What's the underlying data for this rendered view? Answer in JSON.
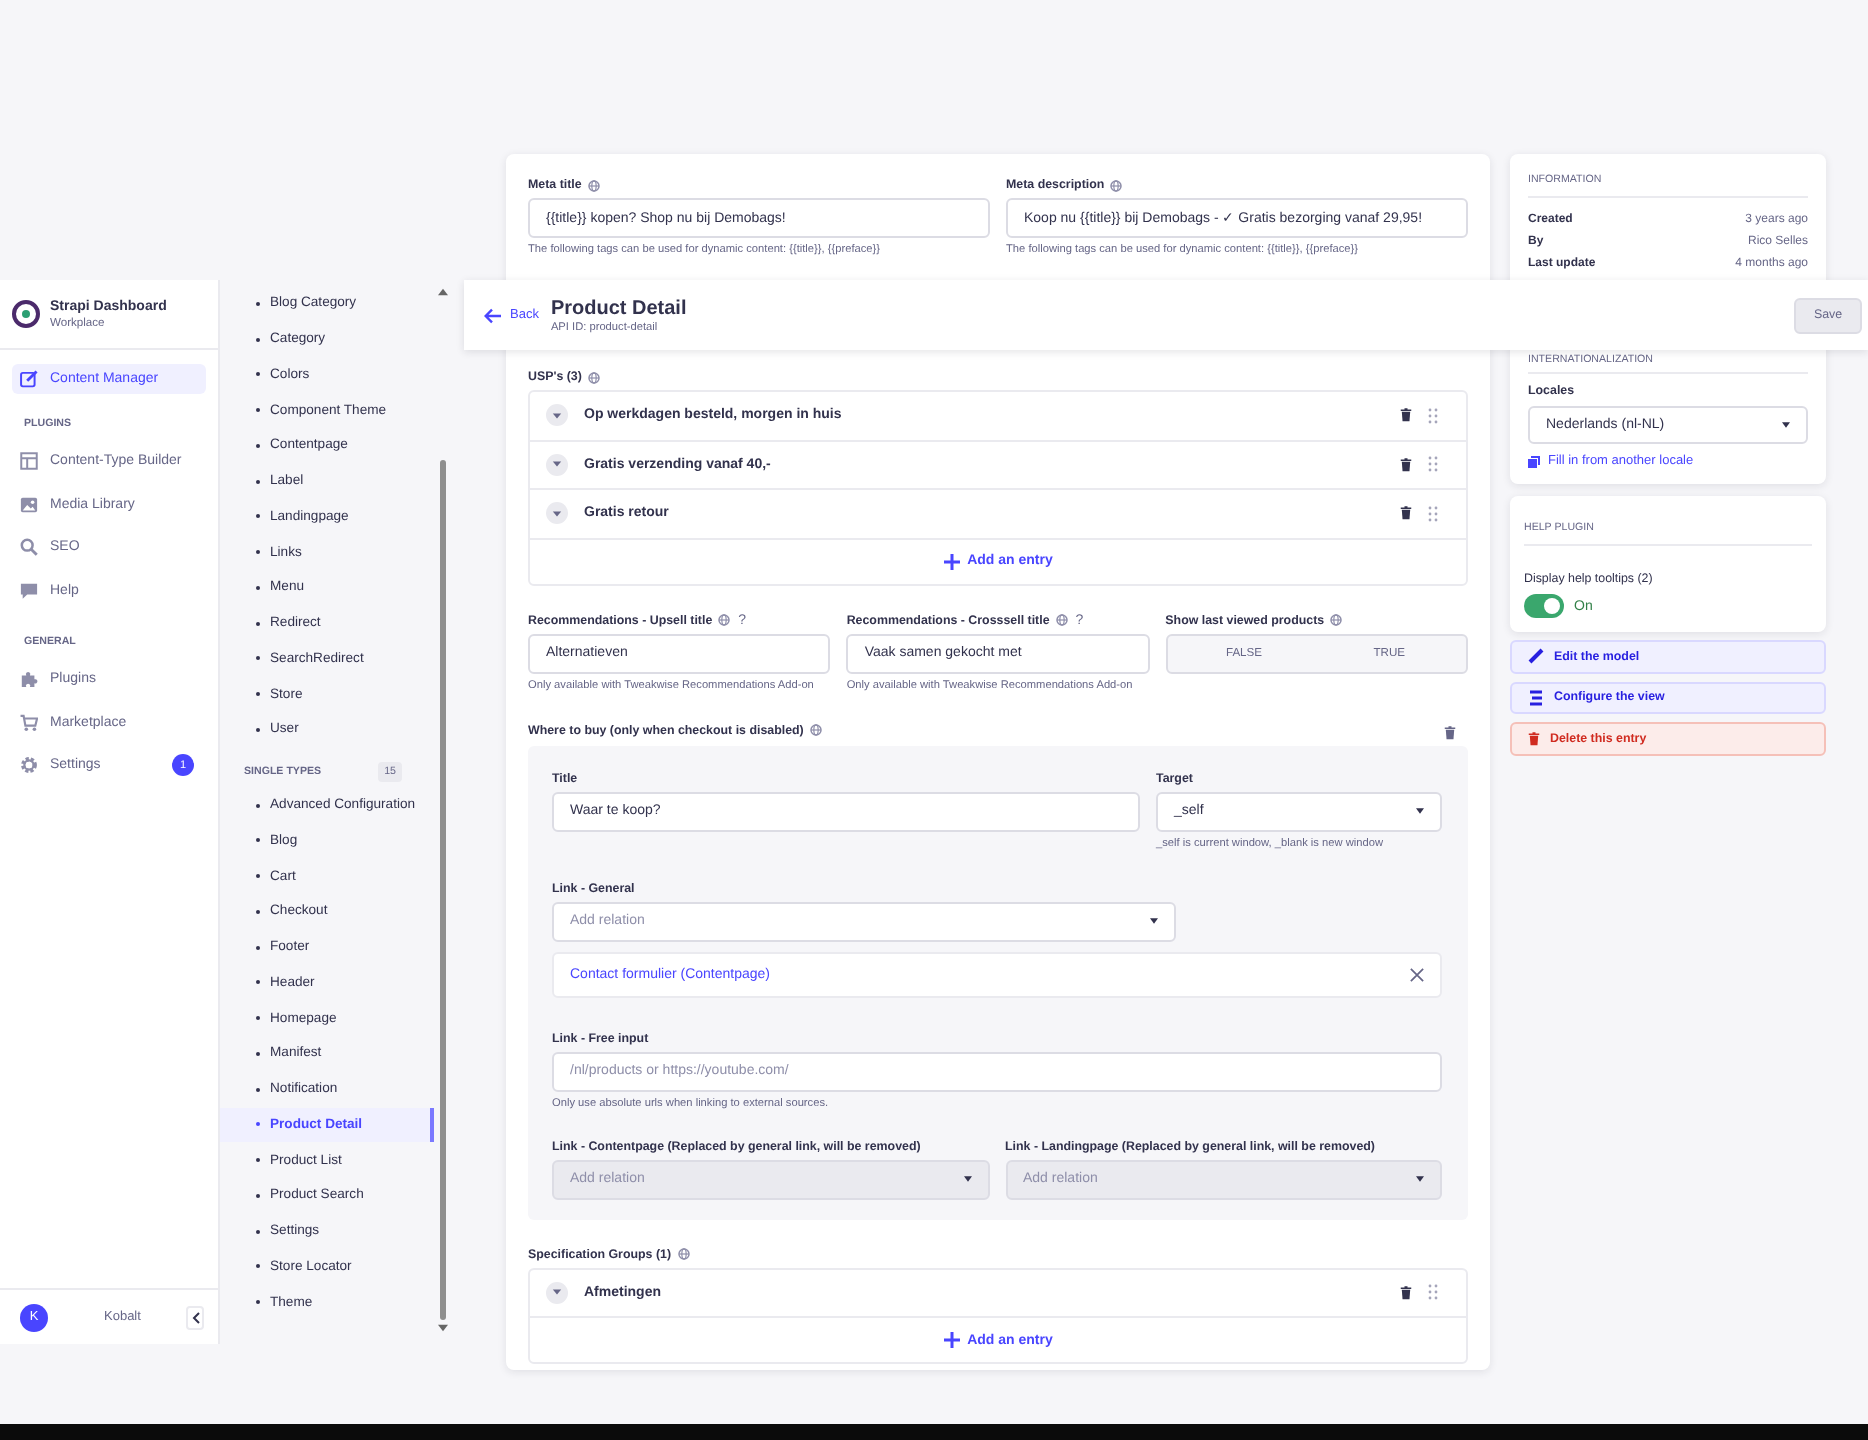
{
  "sidebar": {
    "brand": {
      "title": "Strapi Dashboard",
      "subtitle": "Workplace"
    },
    "items": [
      {
        "label": "Content Manager",
        "selected": true
      }
    ],
    "groups": [
      {
        "heading": "PLUGINS",
        "items": [
          {
            "label": "Content-Type Builder",
            "selected": false
          },
          {
            "label": "Media Library",
            "selected": false
          },
          {
            "label": "SEO",
            "selected": false
          },
          {
            "label": "Help",
            "selected": false
          }
        ]
      },
      {
        "heading": "GENERAL",
        "items": [
          {
            "label": "Plugins",
            "selected": false
          },
          {
            "label": "Marketplace",
            "selected": false
          },
          {
            "label": "Settings",
            "selected": false,
            "badge": "1"
          }
        ]
      }
    ],
    "user": {
      "initial": "K",
      "name": "Kobalt"
    }
  },
  "content_types": {
    "collection_types": [
      {
        "label": "Blog Category",
        "selected": false
      },
      {
        "label": "Category",
        "selected": false
      },
      {
        "label": "Colors",
        "selected": false
      },
      {
        "label": "Component Theme",
        "selected": false
      },
      {
        "label": "Contentpage",
        "selected": false
      },
      {
        "label": "Label",
        "selected": false
      },
      {
        "label": "Landingpage",
        "selected": false
      },
      {
        "label": "Links",
        "selected": false
      },
      {
        "label": "Menu",
        "selected": false
      },
      {
        "label": "Redirect",
        "selected": false
      },
      {
        "label": "SearchRedirect",
        "selected": false
      },
      {
        "label": "Store",
        "selected": false
      },
      {
        "label": "User",
        "selected": false
      }
    ],
    "single_types": {
      "heading": "SINGLE TYPES",
      "count": "15",
      "items": [
        {
          "label": "Advanced Configuration",
          "selected": false
        },
        {
          "label": "Blog",
          "selected": false
        },
        {
          "label": "Cart",
          "selected": false
        },
        {
          "label": "Checkout",
          "selected": false
        },
        {
          "label": "Footer",
          "selected": false
        },
        {
          "label": "Header",
          "selected": false
        },
        {
          "label": "Homepage",
          "selected": false
        },
        {
          "label": "Manifest",
          "selected": false
        },
        {
          "label": "Notification",
          "selected": false
        },
        {
          "label": "Product Detail",
          "selected": true
        },
        {
          "label": "Product List",
          "selected": false
        },
        {
          "label": "Product Search",
          "selected": false
        },
        {
          "label": "Settings",
          "selected": false
        },
        {
          "label": "Store Locator",
          "selected": false
        },
        {
          "label": "Theme",
          "selected": false
        }
      ]
    }
  },
  "header": {
    "back": "Back",
    "title": "Product Detail",
    "api_id": "API ID: product-detail",
    "save": {
      "label": "Save",
      "disabled": true
    }
  },
  "form": {
    "meta": [
      {
        "label": "Meta title",
        "localized": true,
        "value": "{{title}} kopen? Shop nu bij Demobags!",
        "hint": "The following tags can be used for dynamic content: {{title}}, {{preface}}"
      },
      {
        "label": "Meta description",
        "localized": true,
        "value": "Koop nu {{title}} bij Demobags - ✓ Gratis bezorging vanaf 29,95!",
        "hint": "The following tags can be used for dynamic content: {{title}}, {{preface}}"
      }
    ],
    "usps": {
      "label": "USP's (3)",
      "localized": true,
      "entries": [
        "Op werkdagen besteld, morgen in huis",
        "Gratis verzending vanaf 40,-",
        "Gratis retour"
      ],
      "add": "Add an entry"
    },
    "recommendations": [
      {
        "label": "Recommendations - Upsell title",
        "localized": true,
        "tooltip": "?",
        "value": "Alternatieven",
        "hint": "Only available with Tweakwise Recommendations Add-on"
      },
      {
        "label": "Recommendations - Crosssell title",
        "localized": true,
        "tooltip": "?",
        "value": "Vaak samen gekocht met",
        "hint": "Only available with Tweakwise Recommendations Add-on"
      }
    ],
    "last_viewed": {
      "label": "Show last viewed products",
      "localized": true,
      "options": [
        {
          "label": "FALSE",
          "selected": false
        },
        {
          "label": "TRUE",
          "selected": false
        }
      ]
    },
    "where_to_buy": {
      "label": "Where to buy (only when checkout is disabled)",
      "localized": true,
      "title": {
        "label": "Title",
        "value": "Waar te koop?"
      },
      "target": {
        "label": "Target",
        "value": "_self",
        "hint": "_self is current window, _blank is new window"
      },
      "link_general": {
        "label": "Link - General",
        "placeholder": "Add relation",
        "relation": "Contact formulier (Contentpage)"
      },
      "free_input": {
        "label": "Link - Free input",
        "placeholder": "/nl/products or https://youtube.com/",
        "hint": "Only use absolute urls when linking to external sources."
      },
      "legacy_links": [
        {
          "label": "Link - Contentpage (Replaced by general link, will be removed)",
          "placeholder": "Add relation",
          "disabled": true
        },
        {
          "label": "Link - Landingpage (Replaced by general link, will be removed)",
          "placeholder": "Add relation",
          "disabled": true
        }
      ]
    },
    "spec_groups": {
      "label": "Specification Groups (1)",
      "localized": true,
      "entries": [
        "Afmetingen"
      ],
      "add": "Add an entry"
    }
  },
  "panel": {
    "information": {
      "heading": "INFORMATION",
      "rows": [
        {
          "label": "Created",
          "value": "3 years ago"
        },
        {
          "label": "By",
          "value": "Rico Selles"
        },
        {
          "label": "Last update",
          "value": "4 months ago"
        }
      ]
    },
    "i18n": {
      "heading": "INTERNATIONALIZATION",
      "label": "Locales",
      "locale": "Nederlands (nl-NL)",
      "fill_link": "Fill in from another locale"
    },
    "help": {
      "heading": "HELP PLUGIN",
      "label": "Display help tooltips (2)",
      "on": true,
      "state_label": "On"
    },
    "actions": [
      {
        "kind": "primary",
        "label": "Edit the model"
      },
      {
        "kind": "primary",
        "label": "Configure the view"
      },
      {
        "kind": "danger",
        "label": "Delete this entry"
      }
    ]
  }
}
